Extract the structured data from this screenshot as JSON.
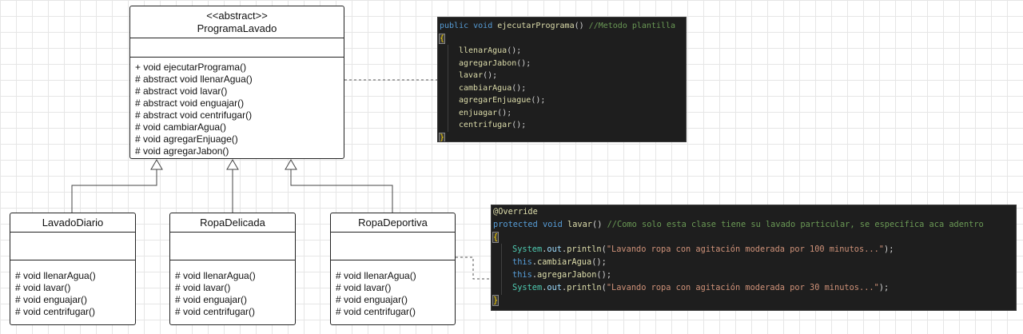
{
  "abstract_class": {
    "stereotype": "<<abstract>>",
    "name": "ProgramaLavado",
    "operations": [
      "+ void ejecutarPrograma()",
      "# abstract void llenarAgua()",
      "# abstract void lavar()",
      "# abstract void enguajar()",
      "# abstract void centrifugar()",
      "# void cambiarAgua()",
      "# void agregarEnjuage()",
      "# void agregarJabon()"
    ]
  },
  "subclasses": [
    {
      "name": "LavadoDiario",
      "operations": [
        "# void llenarAgua()",
        "# void lavar()",
        "# void enguajar()",
        "# void centrifugar()"
      ]
    },
    {
      "name": "RopaDelicada",
      "operations": [
        "# void llenarAgua()",
        "# void lavar()",
        "# void enguajar()",
        "# void centrifugar()"
      ]
    },
    {
      "name": "RopaDeportiva",
      "operations": [
        "# void llenarAgua()",
        "# void lavar()",
        "# void enguajar()",
        "# void centrifugar()"
      ]
    }
  ],
  "code_template": {
    "signature_kw": "public void",
    "signature_fn": "ejecutarPrograma",
    "signature_parens": "()",
    "comment": "//Metodo plantilla",
    "open_brace": "{",
    "calls": [
      "llenarAgua",
      "agregarJabon",
      "lavar",
      "cambiarAgua",
      "agregarEnjuague",
      "enjuagar",
      "centrifugar"
    ],
    "call_suffix": "();",
    "close_brace": "}"
  },
  "code_override": {
    "annotation": "@Override",
    "signature_kw": "protected void",
    "signature_fn": "lavar",
    "signature_parens": "()",
    "comment": "//Como solo esta clase tiene su lavado particular, se especifica aca adentro",
    "open_brace": "{",
    "close_brace": "}",
    "line1_class": "System",
    "line1_field": "out",
    "line1_method": "println",
    "line1_string": "\"Lavando ropa con agitación moderada por 100 minutos...\"",
    "line2_this": "this",
    "line2_method": "cambiarAgua",
    "line3_this": "this",
    "line3_method": "agregarJabon",
    "line4_class": "System",
    "line4_field": "out",
    "line4_method": "println",
    "line4_string": "\"Lavando ropa con agitación moderada por 30 minutos...\"",
    "dot": ".",
    "open_paren": "(",
    "close_stmt": ");",
    "call_suffix": "();"
  }
}
